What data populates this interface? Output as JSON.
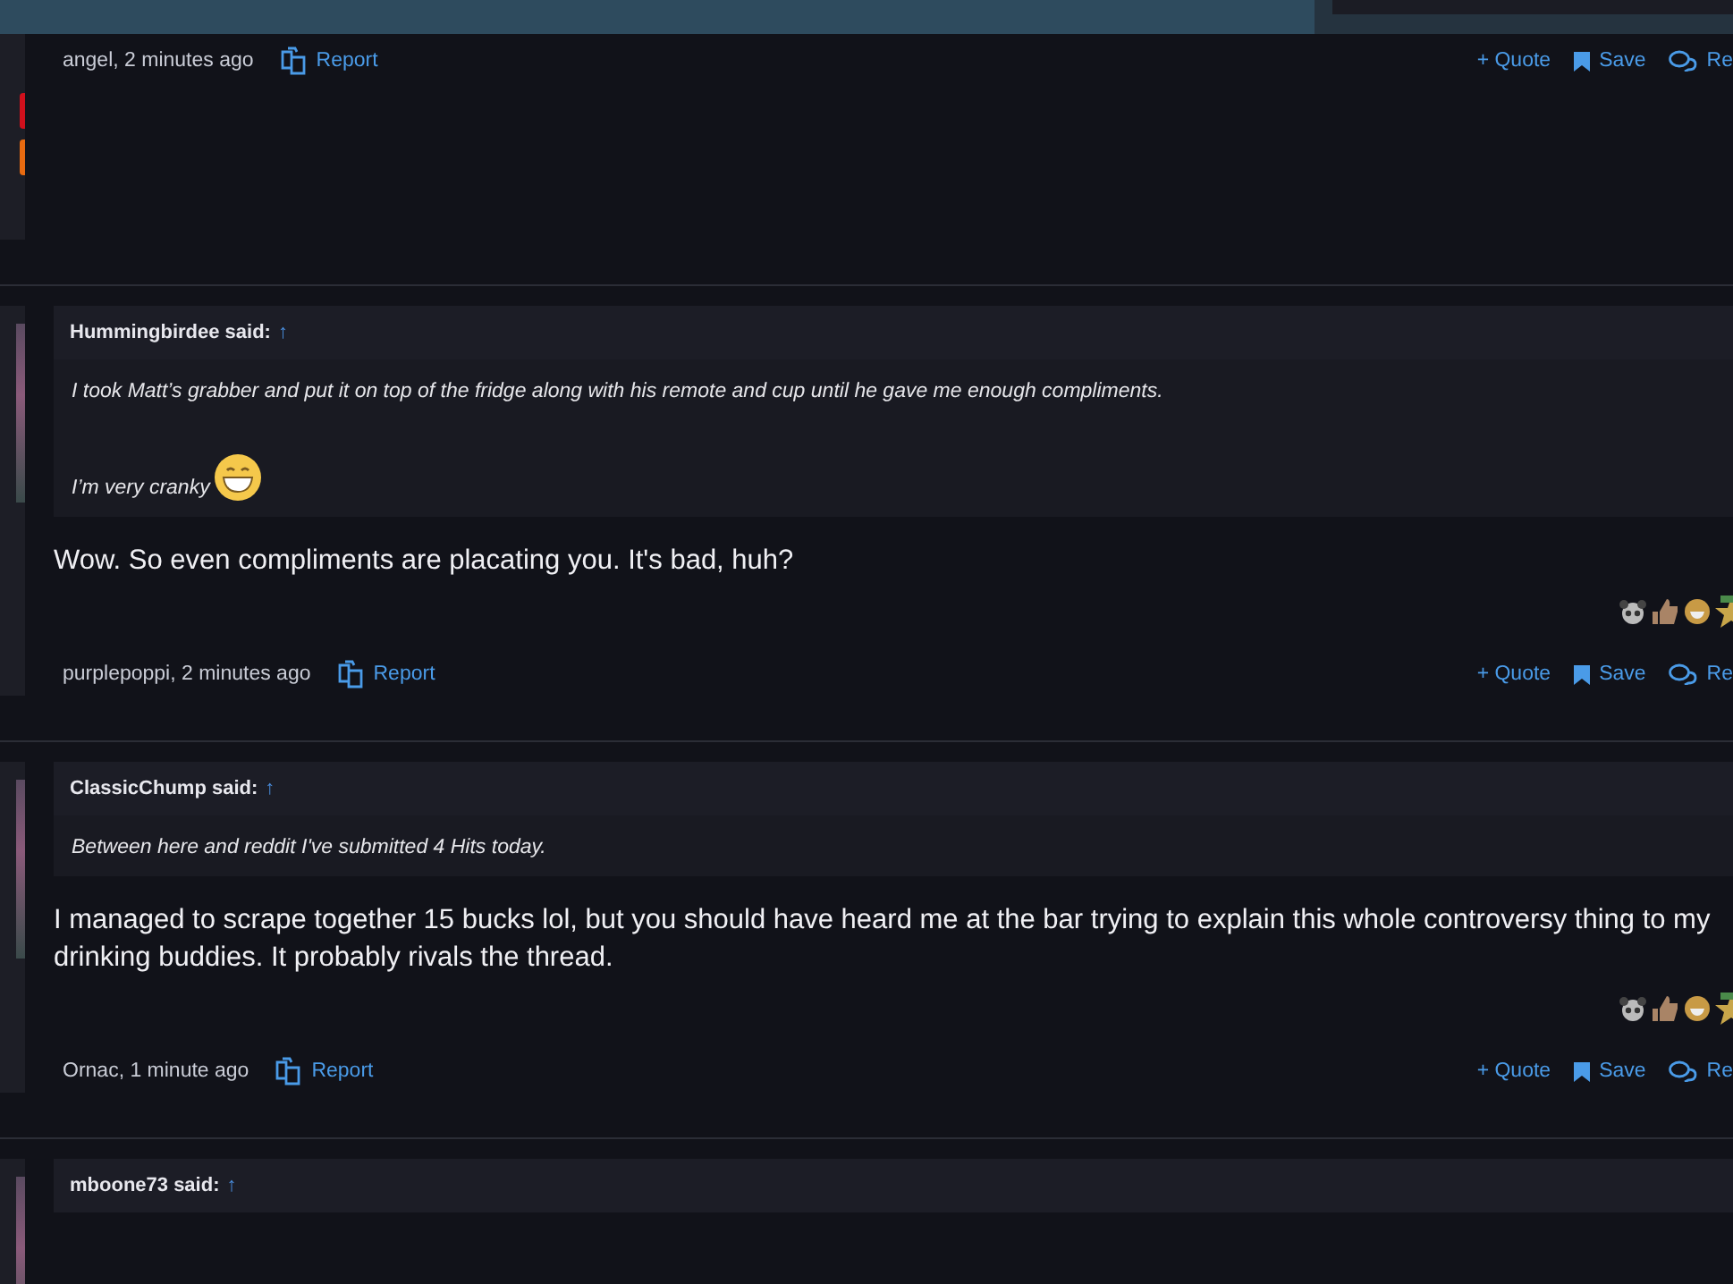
{
  "posts": [
    {
      "meta": "angel, 2 minutes ago",
      "report": "Report",
      "actions": [
        {
          "kind": "quote",
          "label": "+ Quote"
        },
        {
          "kind": "save",
          "label": "Save"
        },
        {
          "kind": "reply",
          "label": "Re"
        }
      ]
    },
    {
      "quote": {
        "author": "Hummingbirdee said:",
        "arrow": "↑",
        "lines": [
          {
            "text": "I took Matt’s grabber and put it on top of the fridge along with his remote and cup until he gave me enough compliments.",
            "emoji": false
          },
          {
            "text": "I’m very cranky",
            "emoji": true
          }
        ]
      },
      "body": [
        "Wow. So even compliments are placating you. It's bad, huh?"
      ],
      "reactions": true,
      "meta": "purplepoppi, 2 minutes ago",
      "report": "Report",
      "actions": [
        {
          "kind": "quote",
          "label": "+ Quote"
        },
        {
          "kind": "save",
          "label": "Save"
        },
        {
          "kind": "reply",
          "label": "Re"
        }
      ]
    },
    {
      "quote": {
        "author": "ClassicChump said:",
        "arrow": "↑",
        "lines": [
          {
            "text": "Between here and reddit I've submitted 4 Hits today.",
            "emoji": false
          }
        ]
      },
      "body": [
        "I managed to scrape together 15 bucks lol, but you should have heard me at the bar trying to explain this whole controversy thing to my drinking buddies. It probably rivals the thread."
      ],
      "reactions": true,
      "meta": "Ornac, 1 minute ago",
      "report": "Report",
      "actions": [
        {
          "kind": "quote",
          "label": "+ Quote"
        },
        {
          "kind": "save",
          "label": "Save"
        },
        {
          "kind": "reply",
          "label": "Re"
        }
      ]
    },
    {
      "quote": {
        "author": "mboone73 said:",
        "arrow": "↑"
      }
    }
  ]
}
